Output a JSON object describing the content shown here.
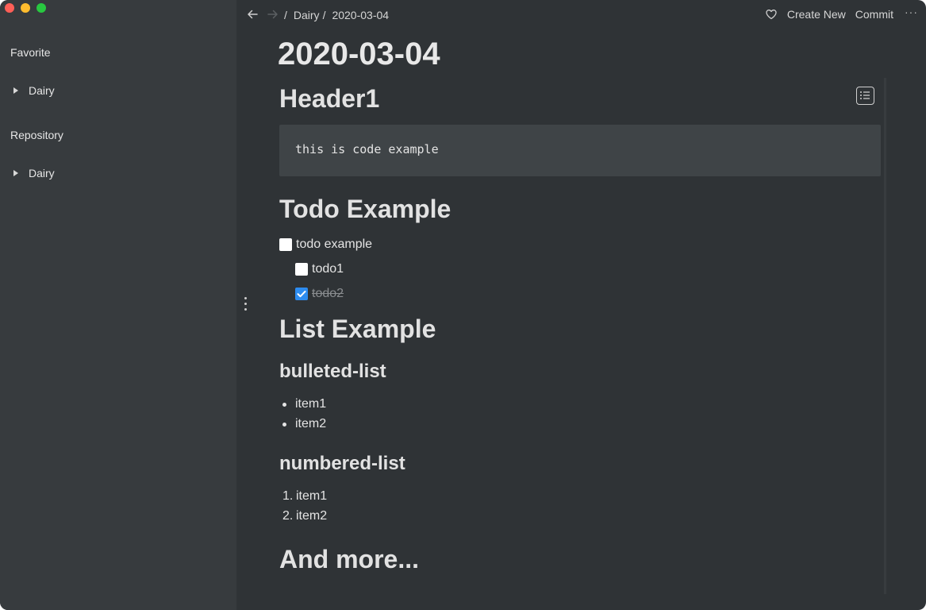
{
  "window": {
    "controls": [
      "close",
      "minimize",
      "zoom"
    ]
  },
  "sidebar": {
    "favorite_heading": "Favorite",
    "favorite_items": [
      {
        "label": "Dairy"
      }
    ],
    "repository_heading": "Repository",
    "repository_items": [
      {
        "label": "Dairy"
      }
    ]
  },
  "toolbar": {
    "back_icon": "arrow-left-icon",
    "forward_icon": "arrow-right-icon",
    "breadcrumb": {
      "separator": "/",
      "items": [
        "Dairy",
        "2020-03-04"
      ]
    },
    "favorite_icon": "heart-icon",
    "create_label": "Create New",
    "commit_label": "Commit",
    "more_label": "···"
  },
  "document": {
    "title": "2020-03-04",
    "header1": "Header1",
    "code": "this is code example",
    "todo_heading": "Todo Example",
    "todos": [
      {
        "label": "todo example",
        "checked": false
      },
      {
        "label": "todo1",
        "checked": false
      },
      {
        "label": "todo2",
        "checked": true
      }
    ],
    "list_heading": "List Example",
    "bulleted_heading": "bulleted-list",
    "bulleted_items": [
      "item1",
      "item2"
    ],
    "numbered_heading": "numbered-list",
    "numbered_items": [
      {
        "marker": "1.",
        "text": "item1"
      },
      {
        "marker": "2.",
        "text": "item2"
      }
    ],
    "more_heading": "And more..."
  },
  "colors": {
    "window_bg": "#2f3336",
    "sidebar_bg": "#373b3e",
    "code_bg": "#3f4447",
    "checkbox_checked": "#2d8cf0"
  }
}
